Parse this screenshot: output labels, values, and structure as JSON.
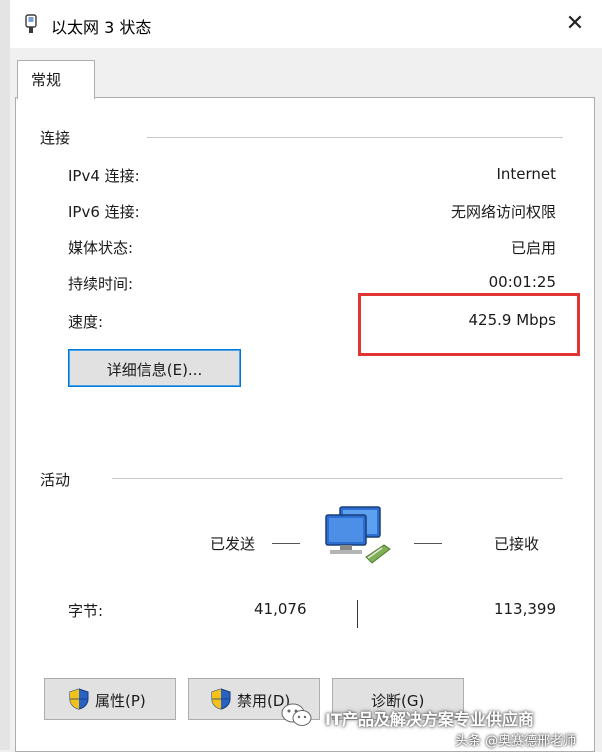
{
  "window": {
    "title": "以太网 3 状态",
    "close_glyph": "✕"
  },
  "tab": {
    "label": "常规"
  },
  "connection": {
    "group_label": "连接",
    "rows": [
      {
        "label": "IPv4 连接:",
        "value": "Internet"
      },
      {
        "label": "IPv6 连接:",
        "value": "无网络访问权限"
      },
      {
        "label": "媒体状态:",
        "value": "已启用"
      },
      {
        "label": "持续时间:",
        "value": "00:01:25"
      },
      {
        "label": "速度:",
        "value": "425.9 Mbps"
      }
    ],
    "details_button": "详细信息(E)...",
    "highlight_color": "#e33434"
  },
  "activity": {
    "group_label": "活动",
    "sent_label": "已发送",
    "received_label": "已接收",
    "bytes_label": "字节:",
    "bytes_sent": "41,076",
    "bytes_received": "113,399",
    "icon": "network-computers-icon"
  },
  "buttons": {
    "properties": "属性(P)",
    "disable": "禁用(D)",
    "diagnose": "诊断(G)"
  },
  "watermark": {
    "main": "IT产品及解决方案专业供应商",
    "sub": "头条 @奥赛德邢老师"
  }
}
